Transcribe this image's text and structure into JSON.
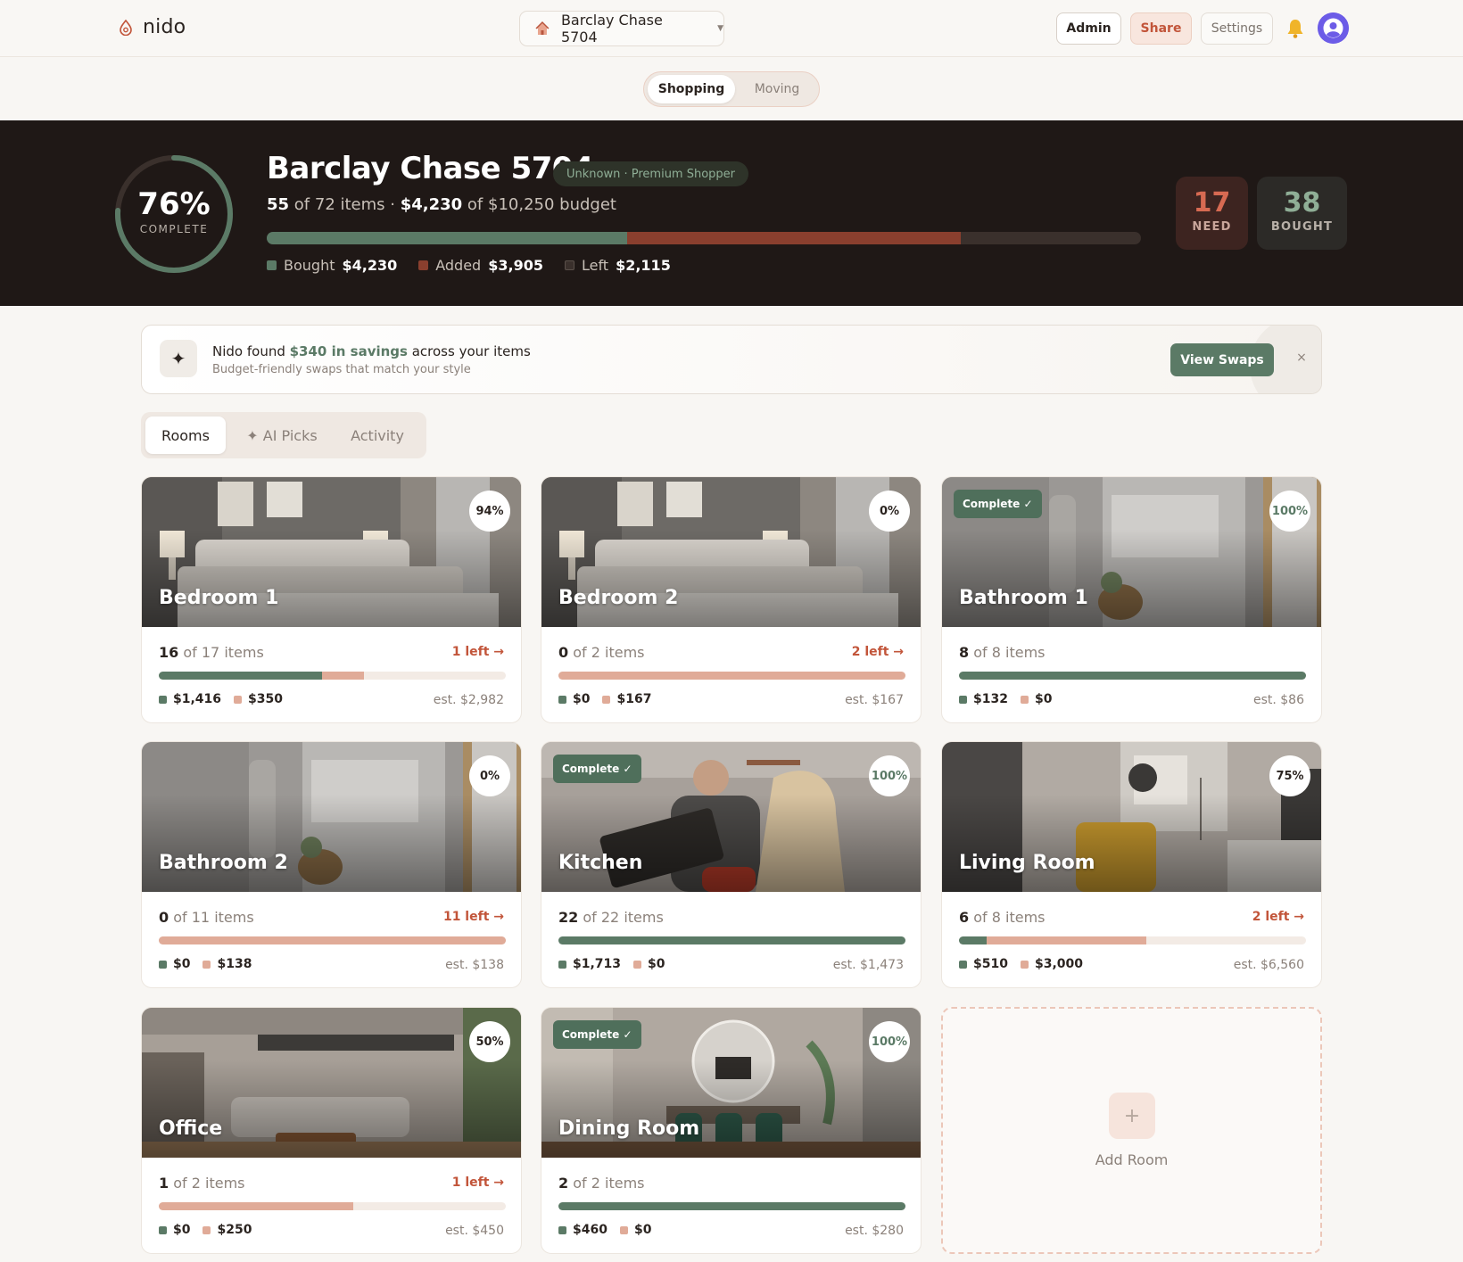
{
  "app": {
    "brand": "nido"
  },
  "nav": {
    "home_selector": "Barclay Chase 5704",
    "admin": "Admin",
    "share": "Share",
    "settings": "Settings"
  },
  "mode_toggle": {
    "shopping": "Shopping",
    "moving": "Moving",
    "selected": "Shopping"
  },
  "hero": {
    "percent": "76%",
    "percent_value": 76,
    "complete_label": "COMPLETE",
    "title": "Barclay Chase 5704",
    "badge": "Unknown · Premium Shopper",
    "items_bought": "55",
    "items_of_text": "of 72 items ·",
    "budget_spent": "$4,230",
    "budget_of_text": "of $10,250 budget",
    "progress": {
      "bought": 0.4127,
      "added": 0.381,
      "left": 0.2063
    },
    "legend": {
      "bought_label": "Bought",
      "bought_value": "$4,230",
      "added_label": "Added",
      "added_value": "$3,905",
      "left_label": "Left",
      "left_value": "$2,115"
    },
    "need_count": "17",
    "need_label": "NEED",
    "bought_count": "38",
    "bought_label": "BOUGHT"
  },
  "banner": {
    "title_pre": "Nido found ",
    "title_hl": "$340 in savings",
    "title_post": " across your items",
    "subtitle": "Budget-friendly swaps that match your style",
    "cta": "View Swaps",
    "close": "×"
  },
  "tabs": {
    "rooms": "Rooms",
    "ai_picks": "✦ AI Picks",
    "activity": "Activity"
  },
  "colors": {
    "bought": "#5b7a66",
    "added": "#e0ab98",
    "brand": "#c2553a",
    "hero_bg": "#1f1816"
  },
  "rooms": [
    {
      "name": "Bedroom 1",
      "percent": "94%",
      "complete": false,
      "count": "16",
      "count_of": "of 17 items",
      "left": "1 left →",
      "bought_frac": 0.47,
      "added_frac": 0.12,
      "bought": "$1,416",
      "added": "$350",
      "est": "est. $2,982"
    },
    {
      "name": "Bedroom 2",
      "percent": "0%",
      "complete": false,
      "count": "0",
      "count_of": "of 2 items",
      "left": "2 left →",
      "bought_frac": 0,
      "added_frac": 1,
      "bought": "$0",
      "added": "$167",
      "est": "est. $167"
    },
    {
      "name": "Bathroom 1",
      "percent": "100%",
      "complete": true,
      "count": "8",
      "count_of": "of 8 items",
      "left": "",
      "bought_frac": 1,
      "added_frac": 0,
      "bought": "$132",
      "added": "$0",
      "est": "est. $86"
    },
    {
      "name": "Bathroom 2",
      "percent": "0%",
      "complete": false,
      "count": "0",
      "count_of": "of 11 items",
      "left": "11 left →",
      "bought_frac": 0,
      "added_frac": 1,
      "bought": "$0",
      "added": "$138",
      "est": "est. $138"
    },
    {
      "name": "Kitchen",
      "percent": "100%",
      "complete": true,
      "count": "22",
      "count_of": "of 22 items",
      "left": "",
      "bought_frac": 1,
      "added_frac": 0,
      "bought": "$1,713",
      "added": "$0",
      "est": "est. $1,473"
    },
    {
      "name": "Living Room",
      "percent": "75%",
      "complete": false,
      "count": "6",
      "count_of": "of 8 items",
      "left": "2 left →",
      "bought_frac": 0.08,
      "added_frac": 0.46,
      "bought": "$510",
      "added": "$3,000",
      "est": "est. $6,560"
    },
    {
      "name": "Office",
      "percent": "50%",
      "complete": false,
      "count": "1",
      "count_of": "of 2 items",
      "left": "1 left →",
      "bought_frac": 0,
      "added_frac": 0.56,
      "bought": "$0",
      "added": "$250",
      "est": "est. $450"
    },
    {
      "name": "Dining Room",
      "percent": "100%",
      "complete": true,
      "count": "2",
      "count_of": "of 2 items",
      "left": "",
      "bought_frac": 1,
      "added_frac": 0,
      "bought": "$460",
      "added": "$0",
      "est": "est. $280"
    }
  ],
  "complete_tag": "Complete ✓",
  "add_room": {
    "plus": "+",
    "label": "Add Room"
  }
}
